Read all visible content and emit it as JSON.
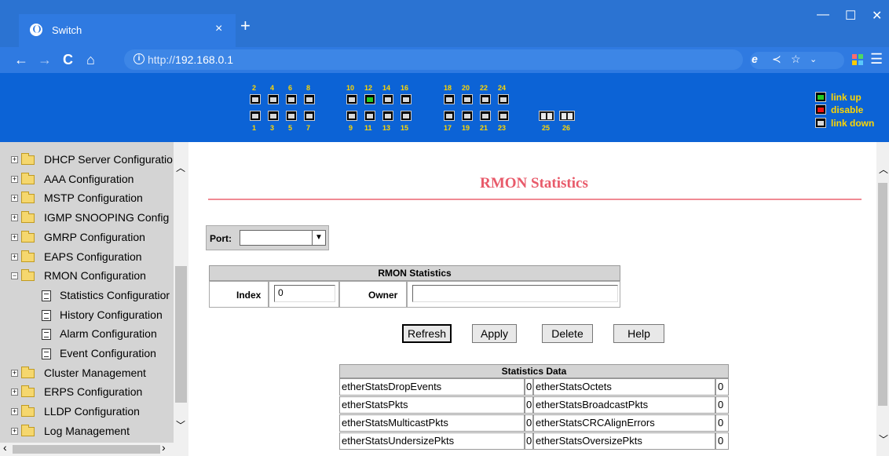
{
  "browser": {
    "tab_title": "Switch",
    "tab_close": "×",
    "new_tab": "+",
    "url_prefix": "http://",
    "url_host": "192.168.0.1",
    "win_minimize": "—",
    "win_maximize": "☐",
    "win_close": "✕"
  },
  "port_panel": {
    "top_labels": [
      "2",
      "4",
      "6",
      "8",
      "10",
      "12",
      "14",
      "16",
      "18",
      "20",
      "22",
      "24"
    ],
    "bottom_labels": [
      "1",
      "3",
      "5",
      "7",
      "9",
      "11",
      "13",
      "15",
      "17",
      "19",
      "21",
      "23"
    ],
    "sfp_labels": [
      "25",
      "26"
    ],
    "link_up_port": "12",
    "legend": [
      {
        "label": "link up",
        "color": "#22cc22"
      },
      {
        "label": "disable",
        "color": "#ee1111"
      },
      {
        "label": "link down",
        "color": "#d8d8d8"
      }
    ]
  },
  "sidebar": {
    "items": [
      {
        "type": "folder",
        "label": "DHCP Server Configuratio",
        "expanded": false
      },
      {
        "type": "folder",
        "label": "AAA Configuration",
        "expanded": false
      },
      {
        "type": "folder",
        "label": "MSTP Configuration",
        "expanded": false
      },
      {
        "type": "folder",
        "label": "IGMP SNOOPING Config",
        "expanded": false
      },
      {
        "type": "folder",
        "label": "GMRP Configuration",
        "expanded": false
      },
      {
        "type": "folder",
        "label": "EAPS Configuration",
        "expanded": false
      },
      {
        "type": "folder",
        "label": "RMON Configuration",
        "expanded": true
      },
      {
        "type": "leaf",
        "label": "Statistics Configuratior"
      },
      {
        "type": "leaf",
        "label": "History Configuration"
      },
      {
        "type": "leaf",
        "label": "Alarm Configuration"
      },
      {
        "type": "leaf",
        "label": "Event Configuration"
      },
      {
        "type": "folder",
        "label": "Cluster Management",
        "expanded": false
      },
      {
        "type": "folder",
        "label": "ERPS Configuration",
        "expanded": false
      },
      {
        "type": "folder",
        "label": "LLDP Configuration",
        "expanded": false
      },
      {
        "type": "folder",
        "label": "Log Management",
        "expanded": false
      }
    ]
  },
  "main": {
    "title": "RMON Statistics",
    "port_label": "Port:",
    "port_value": "",
    "rmon_table": {
      "header": "RMON Statistics",
      "index_label": "Index",
      "index_value": "0",
      "owner_label": "Owner",
      "owner_value": ""
    },
    "buttons": {
      "refresh": "Refresh",
      "apply": "Apply",
      "delete": "Delete",
      "help": "Help"
    },
    "stats": {
      "header": "Statistics Data",
      "rows": [
        {
          "l_name": "etherStatsDropEvents",
          "l_val": "0",
          "r_name": "etherStatsOctets",
          "r_val": "0"
        },
        {
          "l_name": "etherStatsPkts",
          "l_val": "0",
          "r_name": "etherStatsBroadcastPkts",
          "r_val": "0"
        },
        {
          "l_name": "etherStatsMulticastPkts",
          "l_val": "0",
          "r_name": "etherStatsCRCAlignErrors",
          "r_val": "0"
        },
        {
          "l_name": "etherStatsUndersizePkts",
          "l_val": "0",
          "r_name": "etherStatsOversizePkts",
          "r_val": "0"
        }
      ]
    }
  }
}
